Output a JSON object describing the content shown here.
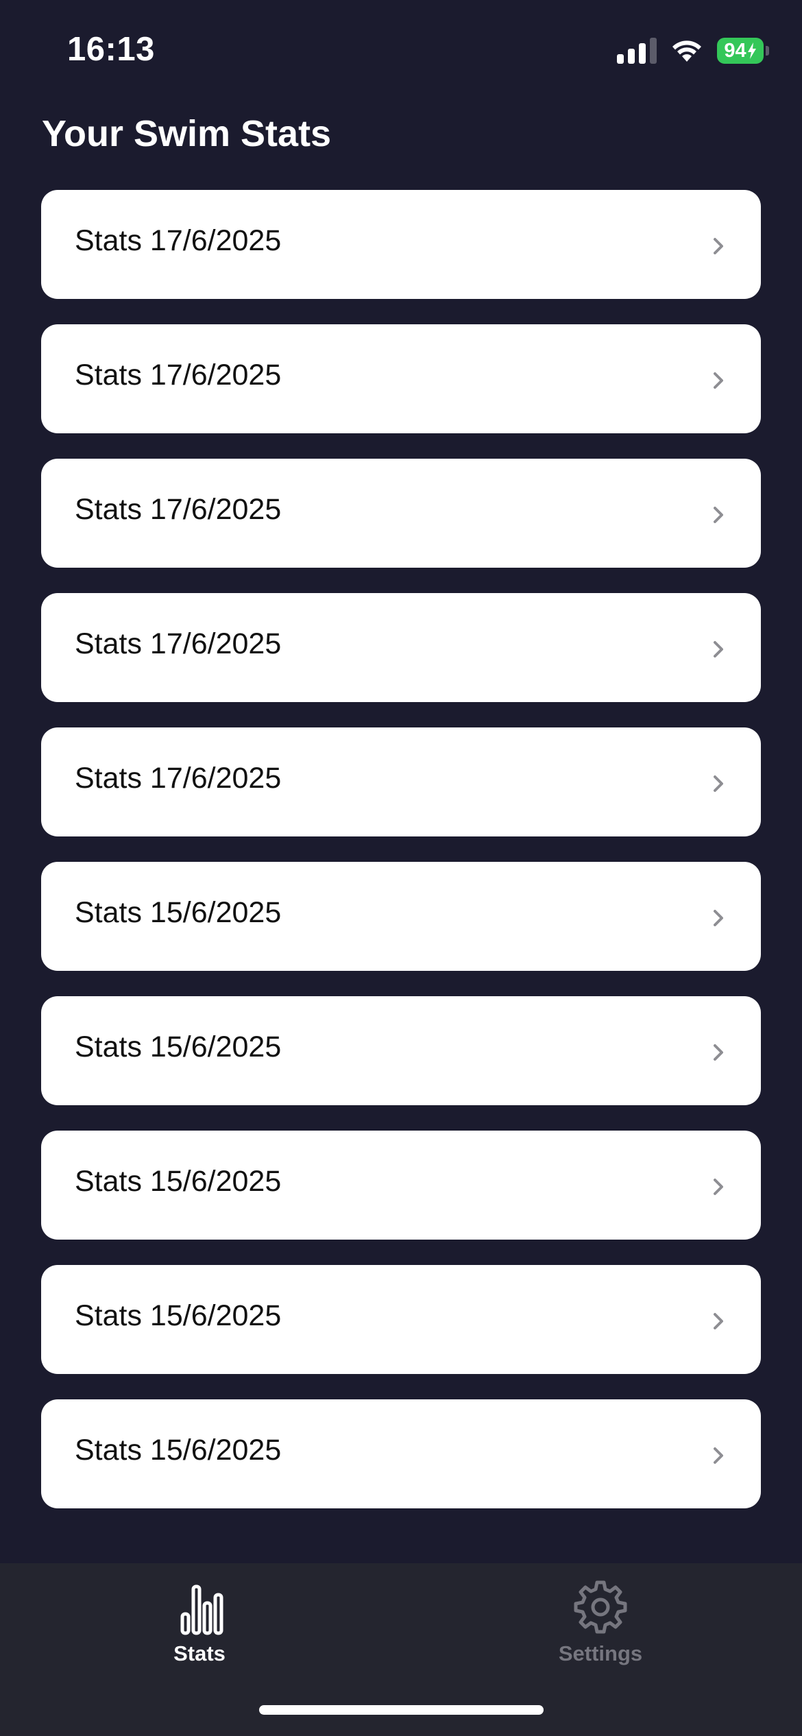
{
  "status_bar": {
    "time": "16:13",
    "battery_percent": "94",
    "battery_color": "#34c759",
    "icons": [
      "cellular-signal-icon",
      "wifi-icon",
      "battery-charging-icon"
    ]
  },
  "page": {
    "title": "Your Swim Stats",
    "background": "#1b1b2e"
  },
  "stats_list": [
    {
      "label": "Stats 17/6/2025"
    },
    {
      "label": "Stats 17/6/2025"
    },
    {
      "label": "Stats 17/6/2025"
    },
    {
      "label": "Stats 17/6/2025"
    },
    {
      "label": "Stats 17/6/2025"
    },
    {
      "label": "Stats 15/6/2025"
    },
    {
      "label": "Stats 15/6/2025"
    },
    {
      "label": "Stats 15/6/2025"
    },
    {
      "label": "Stats 15/6/2025"
    },
    {
      "label": "Stats 15/6/2025"
    }
  ],
  "tab_bar": {
    "tabs": [
      {
        "label": "Stats",
        "icon": "bar-chart-icon",
        "selected": true
      },
      {
        "label": "Settings",
        "icon": "gear-icon",
        "selected": false
      }
    ],
    "active_color": "#ffffff",
    "inactive_color": "#76767f"
  }
}
